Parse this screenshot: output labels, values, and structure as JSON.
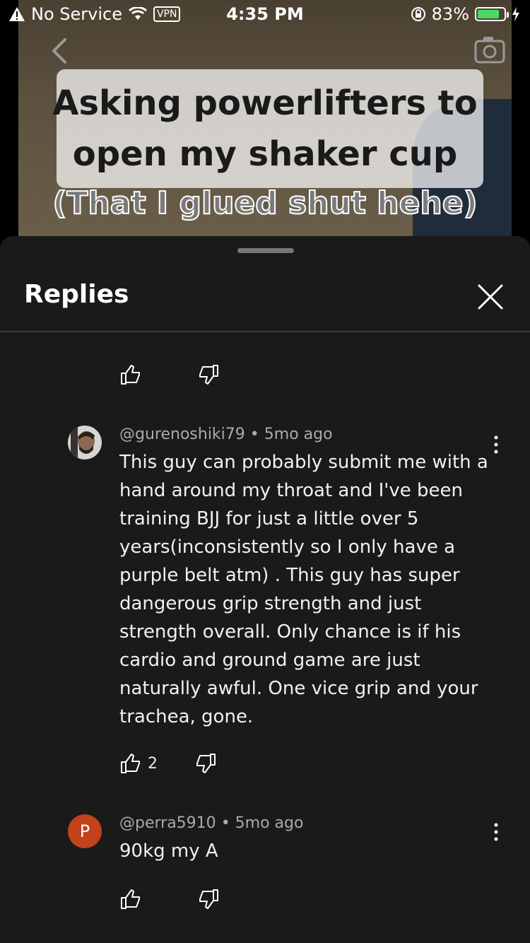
{
  "status_bar": {
    "carrier": "No Service",
    "vpn": "VPN",
    "time": "4:35 PM",
    "battery": "83%",
    "battery_level": 0.83,
    "battery_color": "#4cd964"
  },
  "video": {
    "caption_line1": "Asking powerlifters to",
    "caption_line2": "open my shaker cup",
    "caption_line3": "(That I glued shut hehe)"
  },
  "panel": {
    "title": "Replies"
  },
  "comments": [
    {
      "author": "@gurenoshiki79",
      "age": "5mo ago",
      "text": "This guy can probably submit me with a hand around my throat and I've been training BJJ for just a little over 5 years(inconsistently so I only have a purple belt atm) . This guy has super dangerous grip strength and just strength overall. Only chance is if his cardio and ground game are just naturally awful. One vice grip and your trachea, gone.",
      "likes": "2"
    },
    {
      "author": "@perra5910",
      "age": "5mo ago",
      "text": "90kg my A",
      "avatar_letter": "P",
      "avatar_color": "#c2421c"
    }
  ],
  "icons": [
    "warning-icon",
    "wifi-icon",
    "lock-rotation-icon",
    "charging-icon",
    "back-icon",
    "camera-icon",
    "close-icon",
    "like-icon",
    "dislike-icon",
    "more-vert-icon"
  ]
}
